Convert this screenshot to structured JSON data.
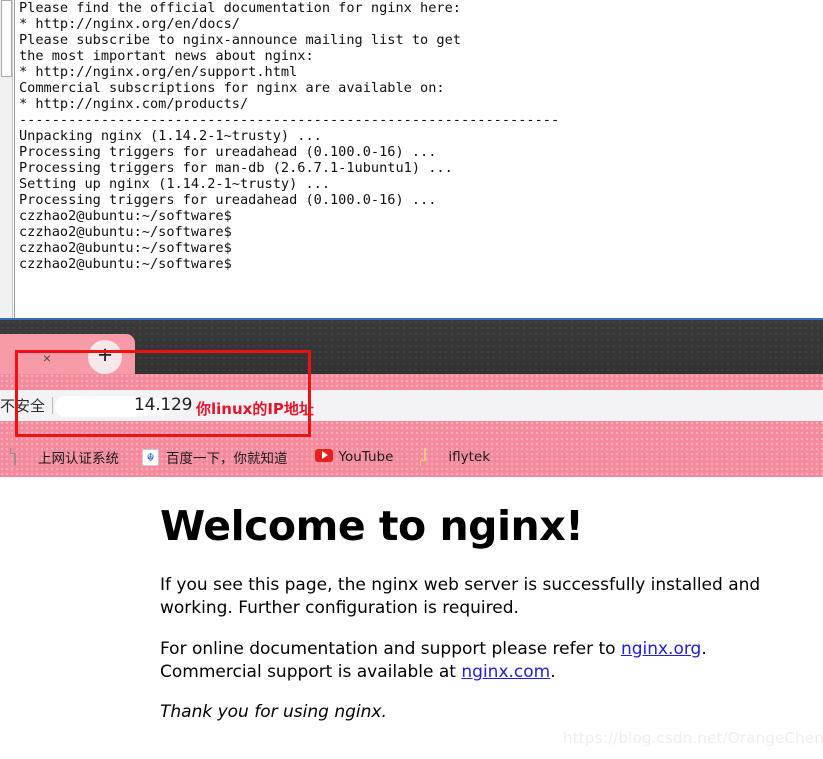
{
  "terminal": {
    "lines": [
      "Please find the official documentation for nginx here:",
      "* http://nginx.org/en/docs/",
      "",
      "Please subscribe to nginx-announce mailing list to get",
      "the most important news about nginx:",
      "* http://nginx.org/en/support.html",
      "",
      "Commercial subscriptions for nginx are available on:",
      "* http://nginx.com/products/",
      "",
      "------------------------------------------------------------------",
      "Unpacking nginx (1.14.2-1~trusty) ...",
      "Processing triggers for ureadahead (0.100.0-16) ...",
      "Processing triggers for man-db (2.6.7.1-1ubuntu1) ...",
      "Setting up nginx (1.14.2-1~trusty) ...",
      "Processing triggers for ureadahead (0.100.0-16) ...",
      "czzhao2@ubuntu:~/software$",
      "czzhao2@ubuntu:~/software$",
      "czzhao2@ubuntu:~/software$",
      "czzhao2@ubuntu:~/software$"
    ]
  },
  "browser": {
    "tab": {
      "close_label": "×"
    },
    "new_tab_label": "+",
    "omnibox": {
      "security_label": "不安全",
      "url_visible": "14.129",
      "annotation": "你linux的IP地址"
    },
    "bookmarks": [
      {
        "label": "上网认证系统",
        "icon": "document-icon"
      },
      {
        "label": "百度一下，你就知道",
        "icon": "baidu-icon"
      },
      {
        "label": "YouTube",
        "icon": "youtube-icon"
      },
      {
        "label": "iflytek",
        "icon": "folder-icon"
      }
    ]
  },
  "page": {
    "heading": "Welcome to nginx!",
    "paragraph1": "If you see this page, the nginx web server is successfully installed and working. Further configuration is required.",
    "paragraph2_pre": "For online documentation and support please refer to ",
    "link1": "nginx.org",
    "paragraph2_mid": ". Commercial support is available at ",
    "link2": "nginx.com",
    "paragraph2_post": ".",
    "thanks": "Thank you for using nginx."
  },
  "watermark": "https://blog.csdn.net/OrangeChenZ",
  "colors": {
    "accent_pink": "#f58a9c",
    "annotation_red": "#ee1111",
    "link_blue": "#2020d8",
    "tabstrip_dark": "#343434"
  }
}
